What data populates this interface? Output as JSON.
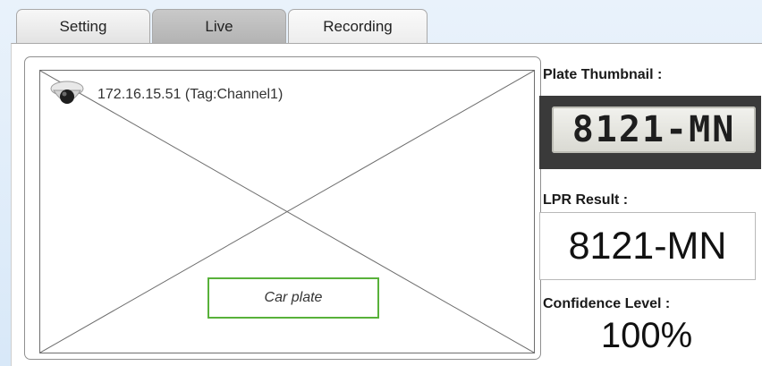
{
  "tabs": [
    {
      "label": "Setting",
      "active": false
    },
    {
      "label": "Live",
      "active": true
    },
    {
      "label": "Recording",
      "active": false
    }
  ],
  "video": {
    "camera_label": "172.16.15.51 (Tag:Channel1)",
    "camera_icon": "dome-camera-icon",
    "plate_region_label": "Car plate",
    "plate_region_color": "#58b13a"
  },
  "result": {
    "thumbnail_label": "Plate Thumbnail :",
    "thumbnail_text": "8121-MN",
    "lpr_label": "LPR Result :",
    "lpr_value": "8121-MN",
    "confidence_label": "Confidence Level :",
    "confidence_value": "100%"
  }
}
